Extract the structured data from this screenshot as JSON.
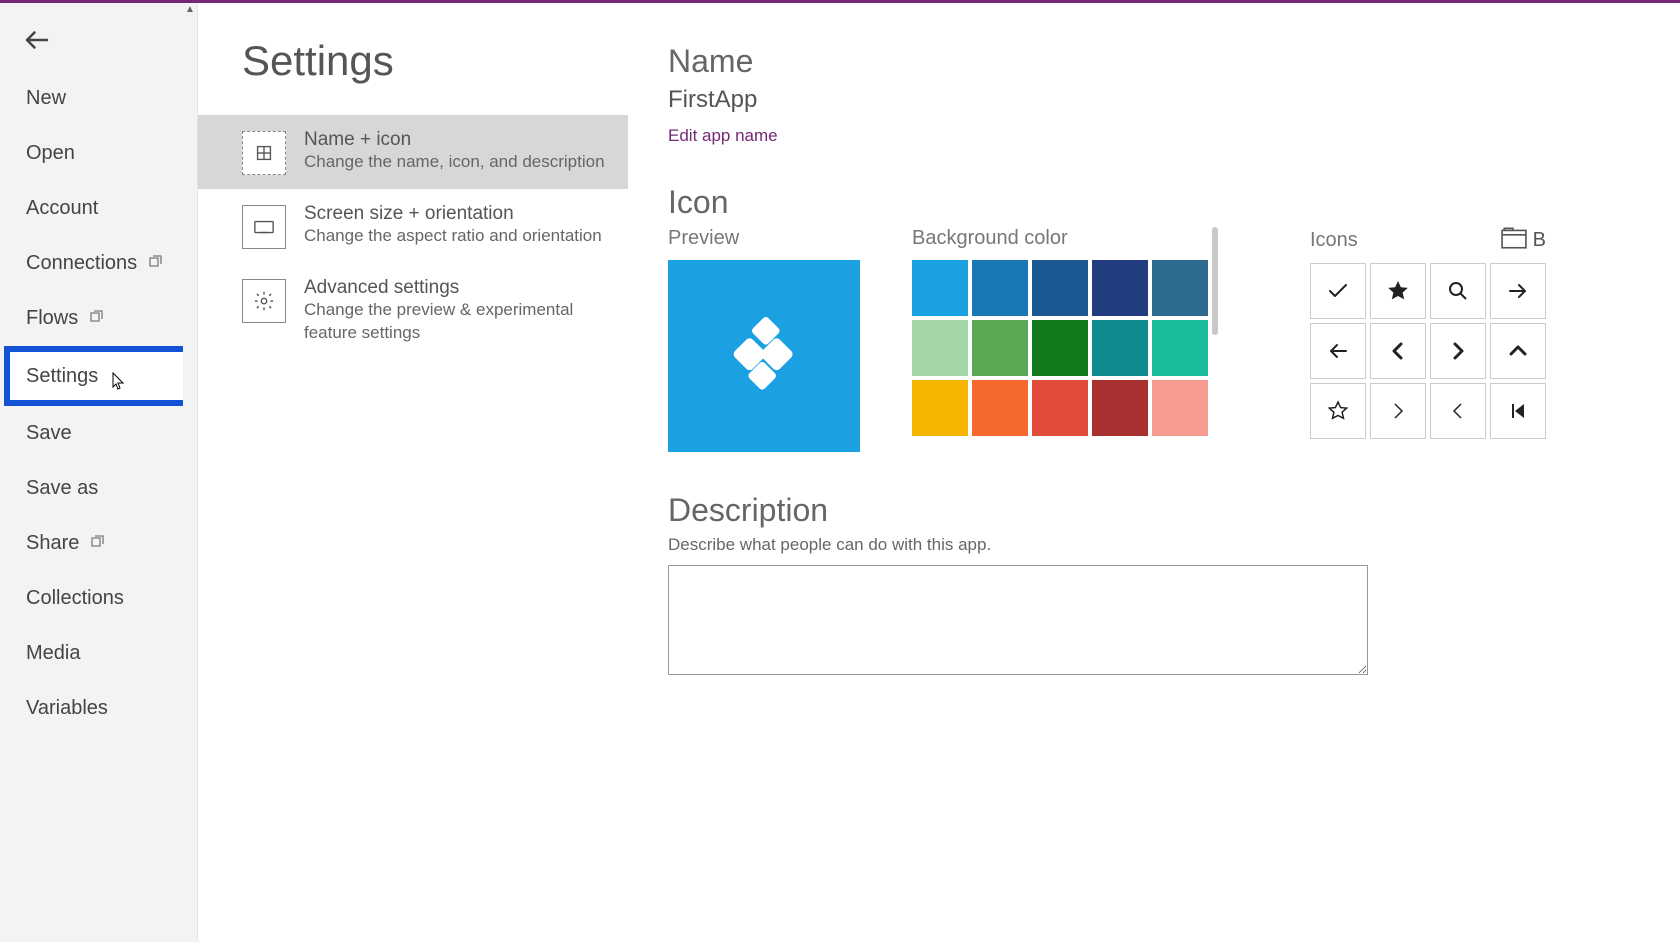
{
  "sidebar": {
    "items": [
      {
        "label": "New"
      },
      {
        "label": "Open"
      },
      {
        "label": "Account"
      },
      {
        "label": "Connections",
        "external": true
      },
      {
        "label": "Flows",
        "external": true
      },
      {
        "label": "Settings",
        "highlighted": true
      },
      {
        "label": "Save"
      },
      {
        "label": "Save as"
      },
      {
        "label": "Share",
        "external": true
      },
      {
        "label": "Collections"
      },
      {
        "label": "Media"
      },
      {
        "label": "Variables"
      }
    ]
  },
  "settings": {
    "title": "Settings",
    "nav": [
      {
        "title": "Name + icon",
        "desc": "Change the name, icon, and description",
        "selected": true,
        "icon": "grid"
      },
      {
        "title": "Screen size + orientation",
        "desc": "Change the aspect ratio and orientation",
        "icon": "screen"
      },
      {
        "title": "Advanced settings",
        "desc": "Change the preview & experimental feature settings",
        "icon": "gear"
      }
    ]
  },
  "main": {
    "name_heading": "Name",
    "app_name": "FirstApp",
    "edit_link": "Edit app name",
    "icon_heading": "Icon",
    "preview_label": "Preview",
    "bg_label": "Background color",
    "icons_label": "Icons",
    "browse_letter": "B",
    "colors": [
      "#1ba1e2",
      "#1778b5",
      "#1a5894",
      "#233e80",
      "#2f6b8e",
      "#a5d6a7",
      "#5aa852",
      "#137a1e",
      "#0f8a8f",
      "#1abc9c",
      "#f5b400",
      "#f56a2c",
      "#e04b3a",
      "#a93030",
      "#f59b90"
    ],
    "icon_options": [
      "check",
      "star-filled",
      "search",
      "arrow-right",
      "arrow-left",
      "chevron-left",
      "chevron-right",
      "chevron-up",
      "star-outline",
      "angle-right",
      "angle-left",
      "skip-back"
    ],
    "desc_heading": "Description",
    "desc_sub": "Describe what people can do with this app.",
    "desc_value": ""
  }
}
